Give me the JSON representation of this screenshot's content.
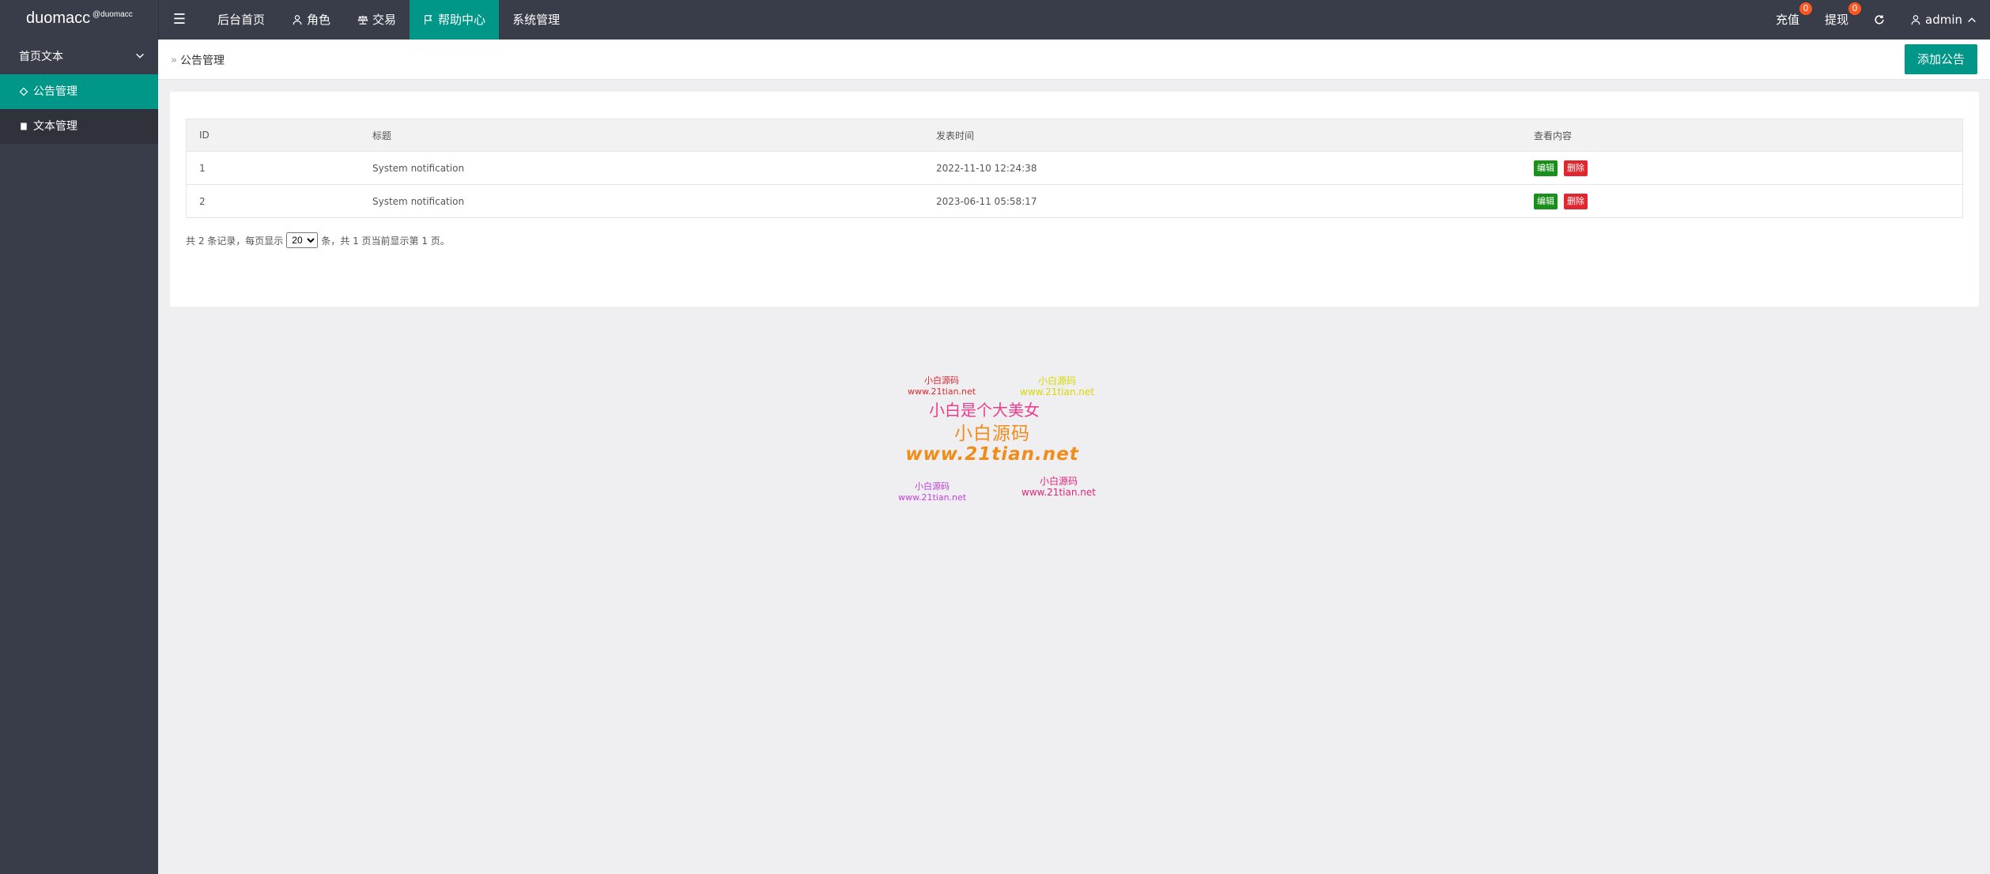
{
  "app": {
    "logo": "duomacc",
    "logo_sup": "@duomacc"
  },
  "topnav": {
    "items": [
      {
        "label": "后台首页"
      },
      {
        "label": "角色"
      },
      {
        "label": "交易"
      },
      {
        "label": "帮助中心"
      },
      {
        "label": "系统管理"
      }
    ],
    "right": {
      "recharge": "充值",
      "recharge_badge": "0",
      "withdraw": "提现",
      "withdraw_badge": "0",
      "user": "admin"
    }
  },
  "sidebar": {
    "header": "首页文本",
    "items": [
      {
        "label": "公告管理"
      },
      {
        "label": "文本管理"
      }
    ]
  },
  "breadcrumb": {
    "current": "公告管理"
  },
  "actions": {
    "add": "添加公告"
  },
  "table": {
    "headers": [
      "ID",
      "标题",
      "发表时间",
      "查看内容"
    ],
    "rows": [
      {
        "id": "1",
        "title": "System notification",
        "time": "2022-11-10 12:24:38"
      },
      {
        "id": "2",
        "title": "System notification",
        "time": "2023-06-11 05:58:17"
      }
    ],
    "edit_label": "编辑",
    "delete_label": "删除"
  },
  "pager": {
    "prefix": "共 2 条记录，每页显示",
    "page_size": "20",
    "suffix": "条，共 1 页当前显示第 1 页。"
  },
  "watermark": {
    "small_name": "小白源码",
    "small_url": "www.21tian.net",
    "slogan": "小白是个大美女",
    "big_name": "小白源码",
    "big_url": "www.21tian.net"
  },
  "colors": {
    "accent": "#009688",
    "nav_bg": "#393d49",
    "badge": "#ff5722",
    "edit": "#1b8f1b",
    "delete": "#e0262f"
  }
}
